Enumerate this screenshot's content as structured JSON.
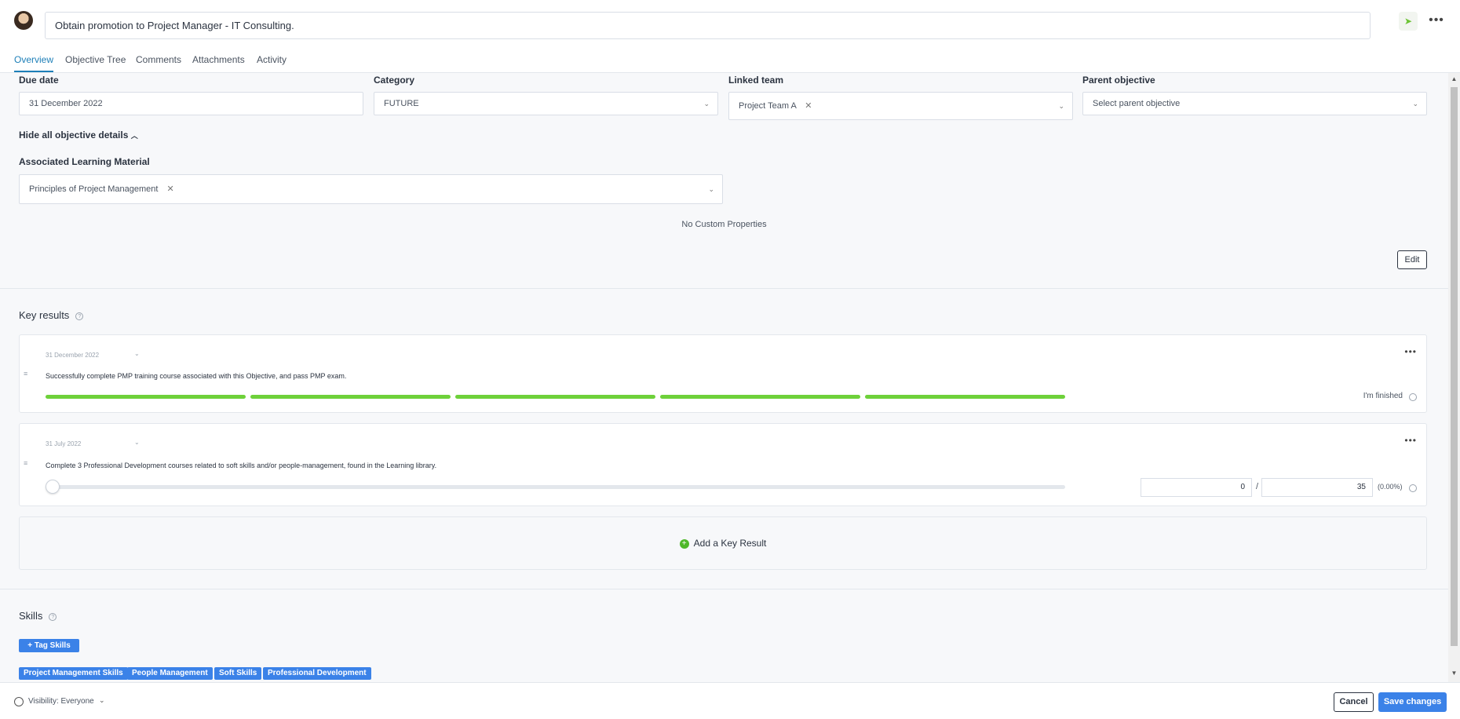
{
  "header": {
    "title_value": "Obtain promotion to Project Manager - IT Consulting.",
    "send_icon": "send-icon",
    "more_icon": "more-icon",
    "more_label": "•••"
  },
  "tabs": [
    {
      "label": "Overview",
      "active": true
    },
    {
      "label": "Objective Tree"
    },
    {
      "label": "Comments"
    },
    {
      "label": "Attachments"
    },
    {
      "label": "Activity"
    }
  ],
  "details": {
    "due_date": {
      "label": "Due date",
      "value": "31 December 2022"
    },
    "category": {
      "label": "Category",
      "value": "FUTURE"
    },
    "linked_team": {
      "label": "Linked team",
      "value": "Project Team A"
    },
    "parent_objective": {
      "label": "Parent objective",
      "placeholder": "Select parent objective"
    },
    "hide_details_label": "Hide all objective details",
    "learning_material": {
      "label": "Associated Learning Material",
      "value": "Principles of Project Management"
    },
    "no_custom_properties": "No Custom Properties",
    "edit_label": "Edit"
  },
  "key_results": {
    "title": "Key results",
    "items": [
      {
        "date": "31 December 2022",
        "text": "Successfully complete PMP training course associated with this Objective, and pass PMP exam.",
        "type": "milestones",
        "segments": 5,
        "completed_segments": 5,
        "finished_label": "I'm finished"
      },
      {
        "date": "31 July 2022",
        "text": "Complete 3 Professional Development courses related to soft skills and/or people-management, found in the Learning library.",
        "type": "numeric",
        "current": "0",
        "target": "35",
        "percent": "(0.00%)"
      }
    ],
    "add_label": "Add a Key Result"
  },
  "skills": {
    "title": "Skills",
    "tag_button": "Tag Skills",
    "tags": [
      "Project Management Skills",
      "People Management",
      "Soft Skills",
      "Professional Development"
    ]
  },
  "footer": {
    "visibility": "Visibility: Everyone",
    "cancel": "Cancel",
    "save": "Save changes"
  },
  "colors": {
    "accent": "#3b82e8",
    "progress": "#6ed13a",
    "tab_active": "#1d7fb8"
  }
}
